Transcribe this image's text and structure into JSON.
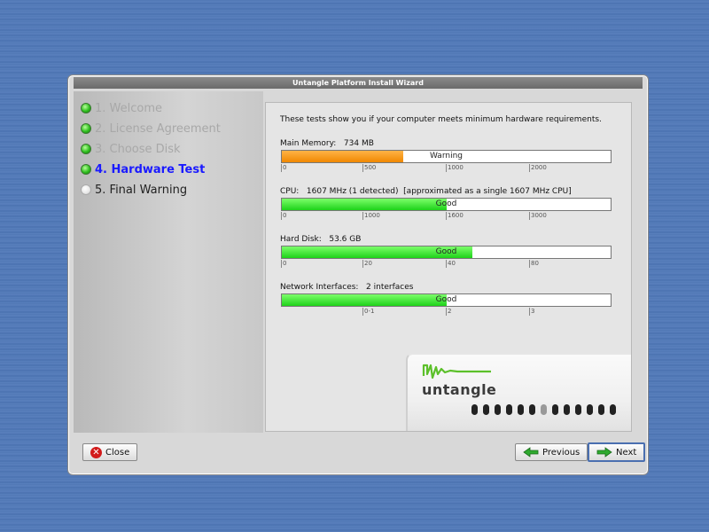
{
  "window": {
    "title": "Untangle Platform Install Wizard"
  },
  "steps": [
    {
      "label": "1. Welcome",
      "state": "done"
    },
    {
      "label": "2. License Agreement",
      "state": "done"
    },
    {
      "label": "3. Choose Disk",
      "state": "done"
    },
    {
      "label": "4. Hardware Test",
      "state": "active"
    },
    {
      "label": "5. Final Warning",
      "state": "next"
    }
  ],
  "content": {
    "intro": "These tests show you if your computer meets minimum hardware requirements.",
    "tests": [
      {
        "label": "Main Memory:   734 MB",
        "status": "Warning",
        "fill_fraction": 0.37,
        "fill_color": "#f29100",
        "scale": [
          "0",
          "500",
          "1000",
          "2000"
        ]
      },
      {
        "label": "CPU:   1607 MHz (1 detected)  [approximated as a single 1607 MHz CPU]",
        "status": "Good",
        "fill_fraction": 0.5,
        "fill_color": "#22d61d",
        "scale": [
          "0",
          "1000",
          "1600",
          "3000"
        ]
      },
      {
        "label": "Hard Disk:   53.6 GB",
        "status": "Good",
        "fill_fraction": 0.58,
        "fill_color": "#22d61d",
        "scale": [
          "0",
          "20",
          "40",
          "80"
        ]
      },
      {
        "label": "Network Interfaces:   2 interfaces",
        "status": "Good",
        "fill_fraction": 0.5,
        "fill_color": "#22d61d",
        "scale": [
          "0-1",
          "2",
          "3"
        ]
      }
    ]
  },
  "device": {
    "logo_text": "untangle",
    "logo_icon": "untangle-wave-logo"
  },
  "buttons": {
    "close": "Close",
    "previous": "Previous",
    "next": "Next"
  }
}
